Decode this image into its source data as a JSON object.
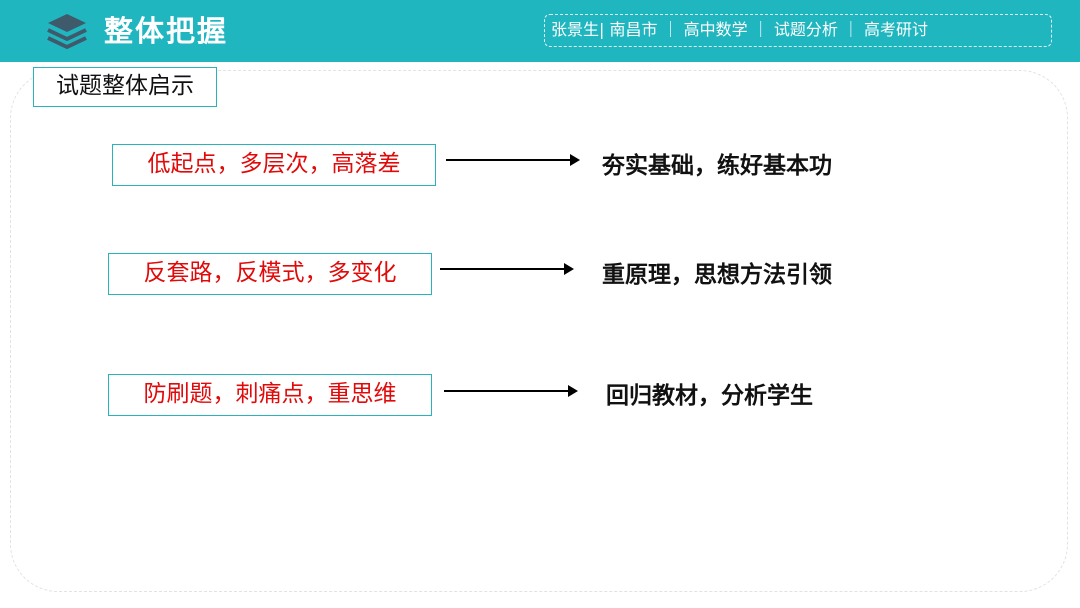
{
  "header": {
    "title": "整体把握",
    "icon": "layers-icon",
    "meta": "张景生| 南昌市 ｜ 高中数学 ｜ 试题分析 ｜ 高考研讨",
    "color": "#20b6c0"
  },
  "section": {
    "label": "试题整体启示"
  },
  "rows": [
    {
      "left": "低起点，多层次，高落差",
      "right": "夯实基础，练好基本功"
    },
    {
      "left": "反套路，反模式，多变化",
      "right": "重原理，思想方法引领"
    },
    {
      "left": "防刷题，刺痛点，重思维",
      "right": "回归教材，分析学生"
    }
  ],
  "colors": {
    "emphasis": "#e10a0a",
    "border": "#2bb3bc"
  }
}
